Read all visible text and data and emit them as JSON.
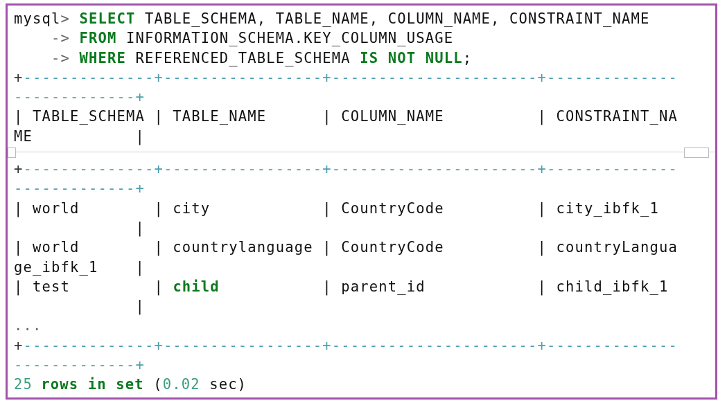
{
  "lines": [
    {
      "kind": "code",
      "tokens": [
        {
          "text": "mysql",
          "kind": "plain"
        },
        {
          "text": "> ",
          "kind": "prompt"
        },
        {
          "text": "SELECT",
          "kind": "keyword"
        },
        {
          "text": " TABLE_SCHEMA, TABLE_NAME, COLUMN_NAME, CONSTRAINT_NAME",
          "kind": "plain"
        }
      ]
    },
    {
      "kind": "code",
      "tokens": [
        {
          "text": "    -> ",
          "kind": "prompt"
        },
        {
          "text": "FROM",
          "kind": "keyword"
        },
        {
          "text": " INFORMATION_SCHEMA.KEY_COLUMN_USAGE",
          "kind": "plain"
        }
      ]
    },
    {
      "kind": "code",
      "tokens": [
        {
          "text": "    -> ",
          "kind": "prompt"
        },
        {
          "text": "WHERE",
          "kind": "keyword"
        },
        {
          "text": " REFERENCED_TABLE_SCHEMA ",
          "kind": "plain"
        },
        {
          "text": "IS NOT NULL",
          "kind": "keyword"
        },
        {
          "text": ";",
          "kind": "plain"
        }
      ]
    },
    {
      "kind": "code",
      "tokens": [
        {
          "text": "+",
          "kind": "corner"
        },
        {
          "text": "--------------+-----------------+----------------------+--------------",
          "kind": "dash"
        }
      ]
    },
    {
      "kind": "code",
      "tokens": [
        {
          "text": "-------------+",
          "kind": "dash"
        }
      ]
    },
    {
      "kind": "code",
      "tokens": [
        {
          "text": "| TABLE_SCHEMA | TABLE_NAME      | COLUMN_NAME          | CONSTRAINT_NA",
          "kind": "plain"
        }
      ]
    },
    {
      "kind": "code",
      "tokens": [
        {
          "text": "ME           |",
          "kind": "plain"
        }
      ]
    },
    {
      "kind": "break"
    },
    {
      "kind": "code",
      "tokens": [
        {
          "text": "+",
          "kind": "corner"
        },
        {
          "text": "--------------+-----------------+----------------------+--------------",
          "kind": "dash"
        }
      ]
    },
    {
      "kind": "code",
      "tokens": [
        {
          "text": "-------------+",
          "kind": "dash"
        }
      ]
    },
    {
      "kind": "code",
      "tokens": [
        {
          "text": "| world        | city            | CountryCode          | city_ibfk_1",
          "kind": "plain"
        }
      ]
    },
    {
      "kind": "code",
      "tokens": [
        {
          "text": "             |",
          "kind": "plain"
        }
      ]
    },
    {
      "kind": "code",
      "tokens": [
        {
          "text": "| world        | countrylanguage | CountryCode          | countryLangua",
          "kind": "plain"
        }
      ]
    },
    {
      "kind": "code",
      "tokens": [
        {
          "text": "ge_ibfk_1    |",
          "kind": "plain"
        }
      ]
    },
    {
      "kind": "code",
      "tokens": [
        {
          "text": "| test         | ",
          "kind": "plain"
        },
        {
          "text": "child",
          "kind": "keyword"
        },
        {
          "text": "           | parent_id            | child_ibfk_1",
          "kind": "plain"
        }
      ]
    },
    {
      "kind": "code",
      "tokens": [
        {
          "text": "             |",
          "kind": "plain"
        }
      ]
    },
    {
      "kind": "code",
      "tokens": [
        {
          "text": "...",
          "kind": "prompt"
        }
      ]
    },
    {
      "kind": "code",
      "tokens": [
        {
          "text": "+",
          "kind": "corner"
        },
        {
          "text": "--------------+-----------------+----------------------+--------------",
          "kind": "dash"
        }
      ]
    },
    {
      "kind": "code",
      "tokens": [
        {
          "text": "-------------+",
          "kind": "dash"
        }
      ]
    },
    {
      "kind": "code",
      "tokens": [
        {
          "text": "25",
          "kind": "number"
        },
        {
          "text": "rows in set",
          "kind": "keyword"
        },
        {
          "text": " (",
          "kind": "plain"
        },
        {
          "text": "0.02",
          "kind": "number"
        },
        {
          "text": " sec)",
          "kind": "plain"
        }
      ]
    }
  ]
}
